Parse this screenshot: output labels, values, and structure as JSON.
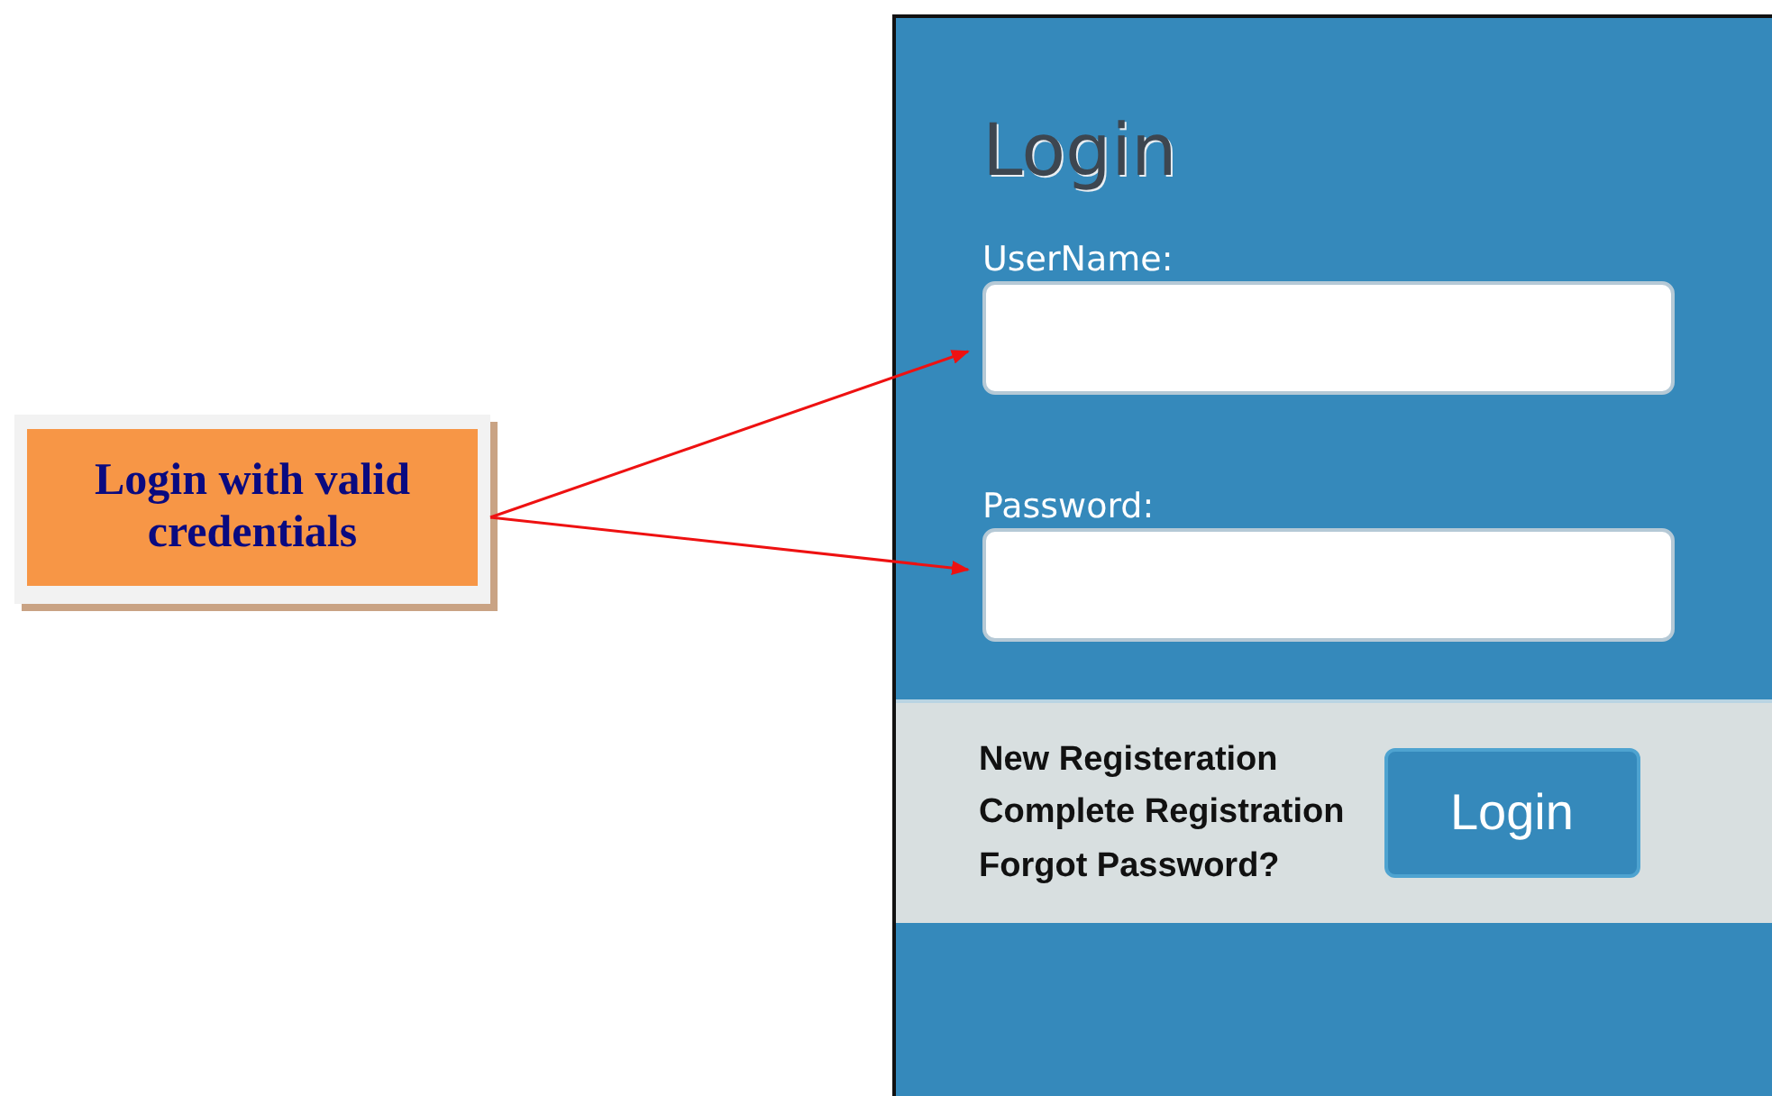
{
  "callout": {
    "text": "Login with valid credentials"
  },
  "login_panel": {
    "title": "Login",
    "fields": [
      {
        "label": "UserName:"
      },
      {
        "label": "Password:"
      }
    ],
    "links": [
      "New Registeration",
      "Complete Registration",
      "Forgot Password?"
    ],
    "button": "Login"
  }
}
